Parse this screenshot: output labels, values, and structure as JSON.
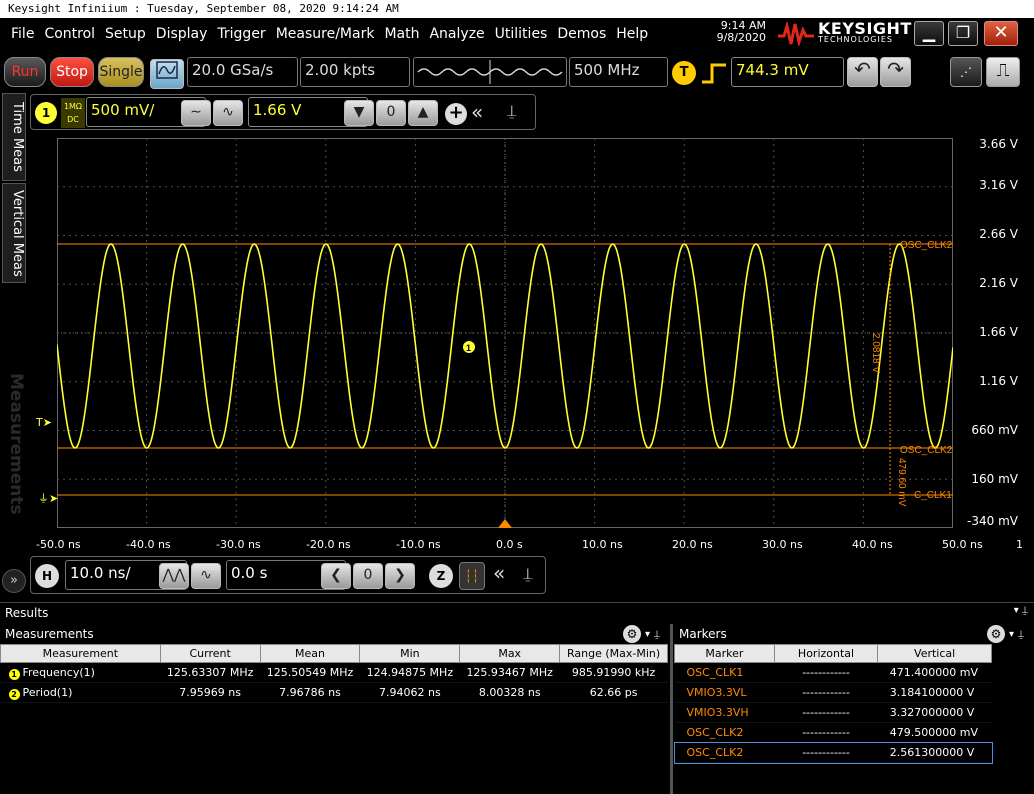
{
  "window": {
    "title": "Keysight Infiniium : Tuesday, September 08, 2020 9:14:24 AM"
  },
  "menu": [
    "File",
    "Control",
    "Setup",
    "Display",
    "Trigger",
    "Measure/Mark",
    "Math",
    "Analyze",
    "Utilities",
    "Demos",
    "Help"
  ],
  "clock": {
    "time": "9:14 AM",
    "date": "9/8/2020"
  },
  "brand": {
    "name": "KEYSIGHT",
    "sub": "TECHNOLOGIES"
  },
  "acq": {
    "run": "Run",
    "stop": "Stop",
    "single": "Single",
    "sample_rate": "20.0 GSa/s",
    "memory_depth": "2.00 kpts",
    "bandwidth": "500 MHz",
    "trigger_badge": "T",
    "trigger_level": "744.3 mV"
  },
  "channel": {
    "number": "1",
    "coupling_top": "1MΩ",
    "coupling_bottom": "DC",
    "scale": "500 mV/",
    "offset": "1.66 V"
  },
  "side_tabs": [
    "Time Meas",
    "Vertical Meas"
  ],
  "watermark": "Measurements",
  "scope": {
    "y_labels": [
      "3.66 V",
      "3.16 V",
      "2.66 V",
      "2.16 V",
      "1.66 V",
      "1.16 V",
      "660 mV",
      "160 mV",
      "-340 mV"
    ],
    "x_labels": [
      "-50.0 ns",
      "-40.0 ns",
      "-30.0 ns",
      "-20.0 ns",
      "-10.0 ns",
      "0.0 s",
      "10.0 ns",
      "20.0 ns",
      "30.0 ns",
      "40.0 ns",
      "50.0 ns"
    ],
    "right_edge_label": "1",
    "marker_labels": {
      "top": "OSC_CLK2",
      "mid": "OSC_CLK2",
      "low": "C_CLK1"
    },
    "delta_labels": {
      "upper": "2.0818 V",
      "lower": "479.60 mV"
    },
    "trigger_marker": "T",
    "colors": {
      "trace": "#ffff33",
      "marker": "#ff8a00",
      "grid": "#505050"
    }
  },
  "horizontal": {
    "badge": "H",
    "scale": "10.0 ns/",
    "position": "0.0 s"
  },
  "results": {
    "title": "Results",
    "measurements": {
      "title": "Measurements",
      "headers": [
        "Measurement",
        "Current",
        "Mean",
        "Min",
        "Max",
        "Range (Max-Min)"
      ],
      "rows": [
        {
          "idx": "1",
          "name": "Frequency(1)",
          "current": "125.63307 MHz",
          "mean": "125.50549 MHz",
          "min": "124.94875 MHz",
          "max": "125.93467 MHz",
          "range": "985.91990 kHz"
        },
        {
          "idx": "2",
          "name": "Period(1)",
          "current": "7.95969 ns",
          "mean": "7.96786 ns",
          "min": "7.94062 ns",
          "max": "8.00328 ns",
          "range": "62.66 ps"
        }
      ]
    },
    "markers": {
      "title": "Markers",
      "headers": [
        "Marker",
        "Horizontal",
        "Vertical"
      ],
      "rows": [
        {
          "name": "OSC_CLK1",
          "horizontal": "------------",
          "vertical": "471.400000 mV"
        },
        {
          "name": "VMIO3.3VL",
          "horizontal": "------------",
          "vertical": "3.184100000 V"
        },
        {
          "name": "VMIO3.3VH",
          "horizontal": "------------",
          "vertical": "3.327000000 V"
        },
        {
          "name": "OSC_CLK2",
          "horizontal": "------------",
          "vertical": "479.500000 mV"
        },
        {
          "name": "OSC_CLK2",
          "horizontal": "------------",
          "vertical": "2.561300000 V"
        }
      ]
    }
  }
}
